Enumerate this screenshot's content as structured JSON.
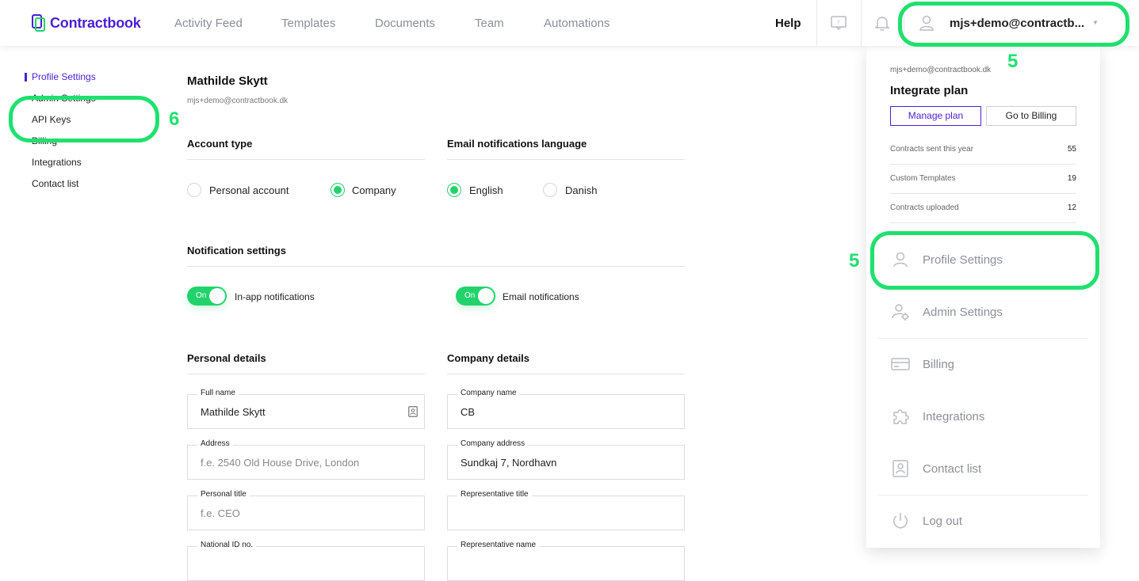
{
  "nav": {
    "logo": "Contractbook",
    "items": [
      "Activity Feed",
      "Templates",
      "Documents",
      "Team",
      "Automations"
    ],
    "help": "Help",
    "user_email": "mjs+demo@contractb..."
  },
  "sidebar": {
    "items": [
      {
        "label": "Profile Settings"
      },
      {
        "label": "Admin Settings"
      },
      {
        "label": "API Keys"
      },
      {
        "label": "Billing"
      },
      {
        "label": "Integrations"
      },
      {
        "label": "Contact list"
      }
    ]
  },
  "profile": {
    "name": "Mathilde Skytt",
    "email": "mjs+demo@contractbook.dk"
  },
  "account_type": {
    "title": "Account type",
    "options": [
      "Personal account",
      "Company"
    ],
    "selected": "Company"
  },
  "language": {
    "title": "Email notifications language",
    "options": [
      "English",
      "Danish"
    ],
    "selected": "English"
  },
  "notifications": {
    "title": "Notification settings",
    "toggle_text": "On",
    "in_app": "In-app notifications",
    "email": "Email notifications"
  },
  "personal_details": {
    "title": "Personal details",
    "fields": [
      {
        "label": "Full name",
        "value": "Mathilde Skytt",
        "placeholder": ""
      },
      {
        "label": "Address",
        "value": "",
        "placeholder": "f.e. 2540 Old House Drive, London"
      },
      {
        "label": "Personal title",
        "value": "",
        "placeholder": "f.e. CEO"
      },
      {
        "label": "National ID no.",
        "value": "",
        "placeholder": ""
      }
    ]
  },
  "company_details": {
    "title": "Company details",
    "fields": [
      {
        "label": "Company name",
        "value": "CB",
        "placeholder": ""
      },
      {
        "label": "Company address",
        "value": "Sundkaj 7, Nordhavn",
        "placeholder": ""
      },
      {
        "label": "Representative title",
        "value": "",
        "placeholder": ""
      },
      {
        "label": "Representative name",
        "value": "",
        "placeholder": ""
      }
    ]
  },
  "dropdown": {
    "email": "mjs+demo@contractbook.dk",
    "plan": "Integrate plan",
    "manage_plan": "Manage plan",
    "go_to_billing": "Go to Billing",
    "stats": [
      {
        "label": "Contracts sent this year",
        "value": "55"
      },
      {
        "label": "Custom Templates",
        "value": "19"
      },
      {
        "label": "Contracts uploaded",
        "value": "12"
      }
    ],
    "menu": [
      {
        "label": "Profile Settings",
        "icon": "user-icon"
      },
      {
        "label": "Admin Settings",
        "icon": "user-gear-icon"
      },
      {
        "label": "Billing",
        "icon": "credit-card-icon"
      },
      {
        "label": "Integrations",
        "icon": "puzzle-icon"
      },
      {
        "label": "Contact list",
        "icon": "contact-card-icon"
      },
      {
        "label": "Log out",
        "icon": "power-icon"
      }
    ]
  },
  "annotations": {
    "user_menu": "5",
    "profile_settings": "5",
    "api_keys": "6"
  },
  "colors": {
    "brand": "#4b1fd6",
    "accent_green": "#22d36b",
    "annotation": "#1fe06e"
  }
}
